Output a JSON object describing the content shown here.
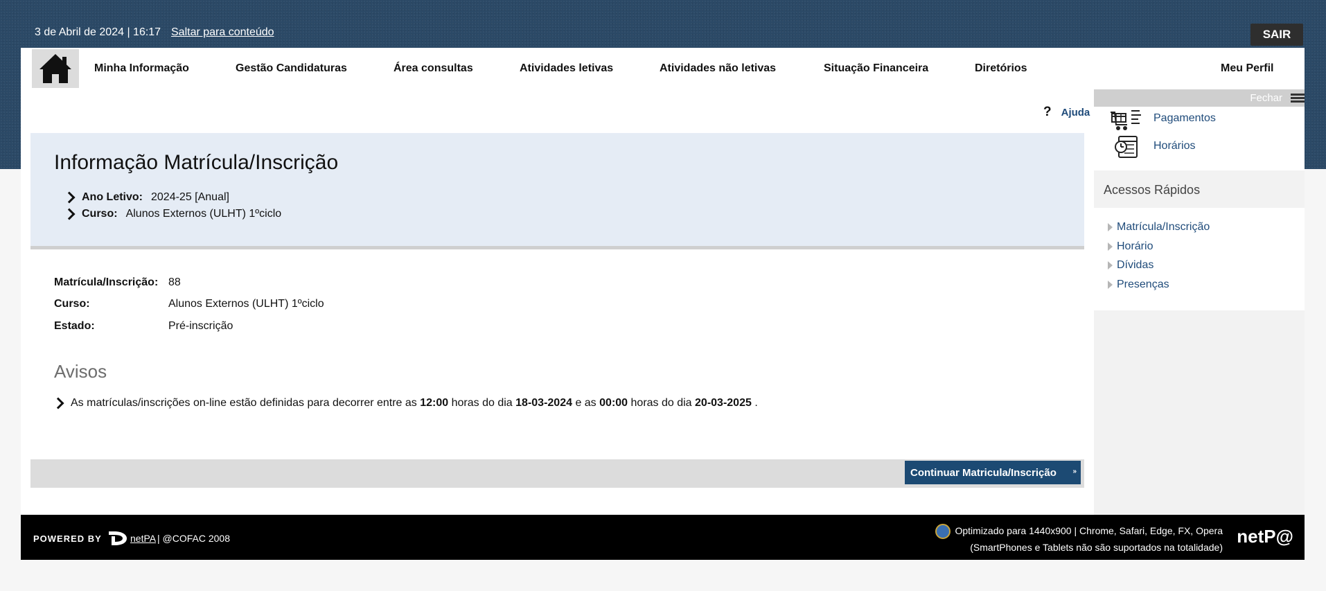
{
  "topbar": {
    "datetime": "3 de Abril de 2024 | 16:17",
    "skip_link": "Saltar para conteúdo",
    "logout": "SAIR"
  },
  "nav": {
    "items": [
      "Minha Informação",
      "Gestão Candidaturas",
      "Área consultas",
      "Atividades letivas",
      "Atividades não letivas",
      "Situação Financeira",
      "Diretórios"
    ],
    "profile": "Meu Perfil"
  },
  "help": {
    "icon": "?",
    "label": "Ajuda"
  },
  "info": {
    "title": "Informação Matrícula/Inscrição",
    "ano_label": "Ano Letivo:",
    "ano_value": "2024-25 [Anual]",
    "curso_label": "Curso:",
    "curso_value": "Alunos Externos (ULHT) 1ºciclo"
  },
  "details": {
    "matricula_label": "Matrícula/Inscrição:",
    "matricula_value": "88",
    "curso_label": "Curso:",
    "curso_value": "Alunos Externos (ULHT) 1ºciclo",
    "estado_label": "Estado:",
    "estado_value": "Pré-inscrição"
  },
  "avisos": {
    "title": "Avisos",
    "t1": "As matrículas/inscrições on-line estão definidas para decorrer entre as",
    "h1": "12:00",
    "t2": "horas do dia",
    "d1": "18-03-2024",
    "t3": "e as",
    "h2": "00:00",
    "t4": "horas do dia",
    "d2": "20-03-2025",
    "t5": "."
  },
  "action": {
    "continue": "Continuar Matricula/Inscrição",
    "arrow": "»"
  },
  "sidebar": {
    "close": "Fechar",
    "links": [
      "Pagamentos",
      "Horários"
    ],
    "quick_title": "Acessos Rápidos",
    "quick_links": [
      "Matrícula/Inscrição",
      "Horário",
      "Dívidas",
      "Presenças"
    ]
  },
  "footer": {
    "powered": "POWERED BY",
    "netpa_link": "netPA",
    "copyright": "| @COFAC 2008",
    "optimized": "Optimizado para 1440x900 | Chrome, Safari, Edge, FX, Opera",
    "note": "(SmartPhones e Tablets não são suportados na totalidade)",
    "brand": "netP@"
  },
  "icons": {
    "home": "home-icon",
    "help": "help-icon",
    "payments": "payments-icon",
    "schedule": "schedule-icon",
    "menu": "hamburger-icon"
  },
  "colors": {
    "link_blue": "#1f4b7a",
    "button_blue": "#1c4a73",
    "info_panel": "#e5ecf5",
    "header_band": "#2b4966"
  }
}
